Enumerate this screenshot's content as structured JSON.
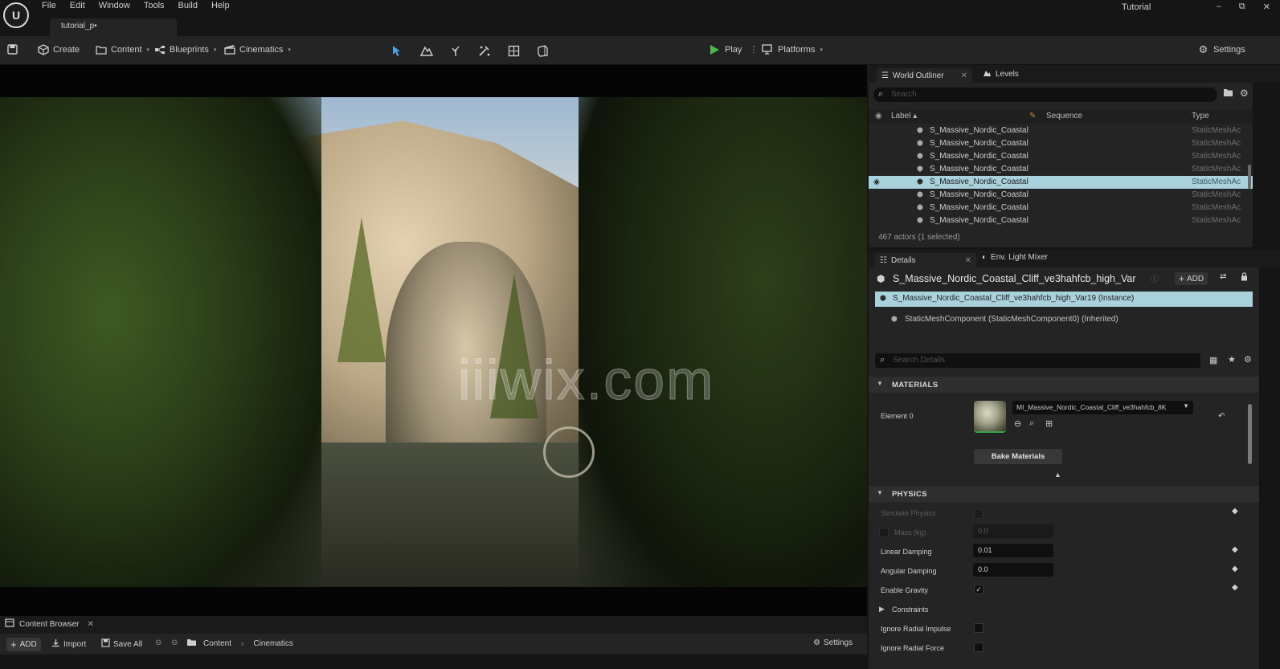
{
  "titlebar": {
    "menu": [
      "File",
      "Edit",
      "Window",
      "Tools",
      "Build",
      "Help"
    ],
    "level_tab": "tutorial_p•",
    "project": "Tutorial",
    "win_min": "–",
    "win_max": "⧉",
    "win_close": "✕"
  },
  "toolbar": {
    "create": "Create",
    "content": "Content",
    "blueprints": "Blueprints",
    "cinematics": "Cinematics",
    "play": "Play",
    "platforms": "Platforms",
    "settings": "Settings"
  },
  "viewport": {
    "watermark": "iiiwix.com"
  },
  "content_browser": {
    "tab_label": "Content Browser",
    "add": "ADD",
    "import": "Import",
    "save_all": "Save All",
    "path": [
      "Content",
      "Cinematics"
    ],
    "settings": "Settings"
  },
  "outliner": {
    "tabs": [
      "World Outliner",
      "Levels"
    ],
    "search_placeholder": "Search",
    "columns": {
      "label": "Label ▴",
      "sequence": "Sequence",
      "type": "Type"
    },
    "rows": [
      {
        "label": "S_Massive_Nordic_Coastal",
        "type": "StaticMeshAc",
        "selected": false
      },
      {
        "label": "S_Massive_Nordic_Coastal",
        "type": "StaticMeshAc",
        "selected": false
      },
      {
        "label": "S_Massive_Nordic_Coastal",
        "type": "StaticMeshAc",
        "selected": false
      },
      {
        "label": "S_Massive_Nordic_Coastal",
        "type": "StaticMeshAc",
        "selected": false
      },
      {
        "label": "S_Massive_Nordic_Coastal",
        "type": "StaticMeshAc",
        "selected": true
      },
      {
        "label": "S_Massive_Nordic_Coastal",
        "type": "StaticMeshAc",
        "selected": false
      },
      {
        "label": "S_Massive_Nordic_Coastal",
        "type": "StaticMeshAc",
        "selected": false
      },
      {
        "label": "S_Massive_Nordic_Coastal",
        "type": "StaticMeshAc",
        "selected": false
      }
    ],
    "status": "467 actors (1 selected)"
  },
  "details": {
    "tabs": [
      "Details",
      "Env. Light Mixer"
    ],
    "actor_name": "S_Massive_Nordic_Coastal_Cliff_ve3hahfcb_high_Var",
    "add": "ADD",
    "component_selected": "S_Massive_Nordic_Coastal_Cliff_ve3hahfcb_high_Var19 (Instance)",
    "component_inherited": "StaticMeshComponent (StaticMeshComponent0) (Inherited)",
    "search_placeholder": "Search Details",
    "materials": {
      "header": "MATERIALS",
      "element_label": "Element 0",
      "material_value": "MI_Massive_Nordic_Coastal_Cliff_ve3hahfcb_8K",
      "bake_button": "Bake Materials"
    },
    "physics": {
      "header": "PHYSICS",
      "simulate_physics": "Simulate Physics",
      "mass_label": "Mass (kg)",
      "mass_value": "0.0",
      "linear_damping_label": "Linear Damping",
      "linear_damping_value": "0.01",
      "angular_damping_label": "Angular Damping",
      "angular_damping_value": "0.0",
      "enable_gravity_label": "Enable Gravity",
      "enable_gravity": true,
      "constraints_label": "Constraints",
      "ignore_radial_impulse_label": "Ignore Radial Impulse",
      "ignore_radial_force_label": "Ignore Radial Force"
    }
  },
  "colors": {
    "selection": "#a9d2dc",
    "play_green": "#4fb548",
    "panel_bg": "#242424",
    "app_bg": "#151515"
  }
}
